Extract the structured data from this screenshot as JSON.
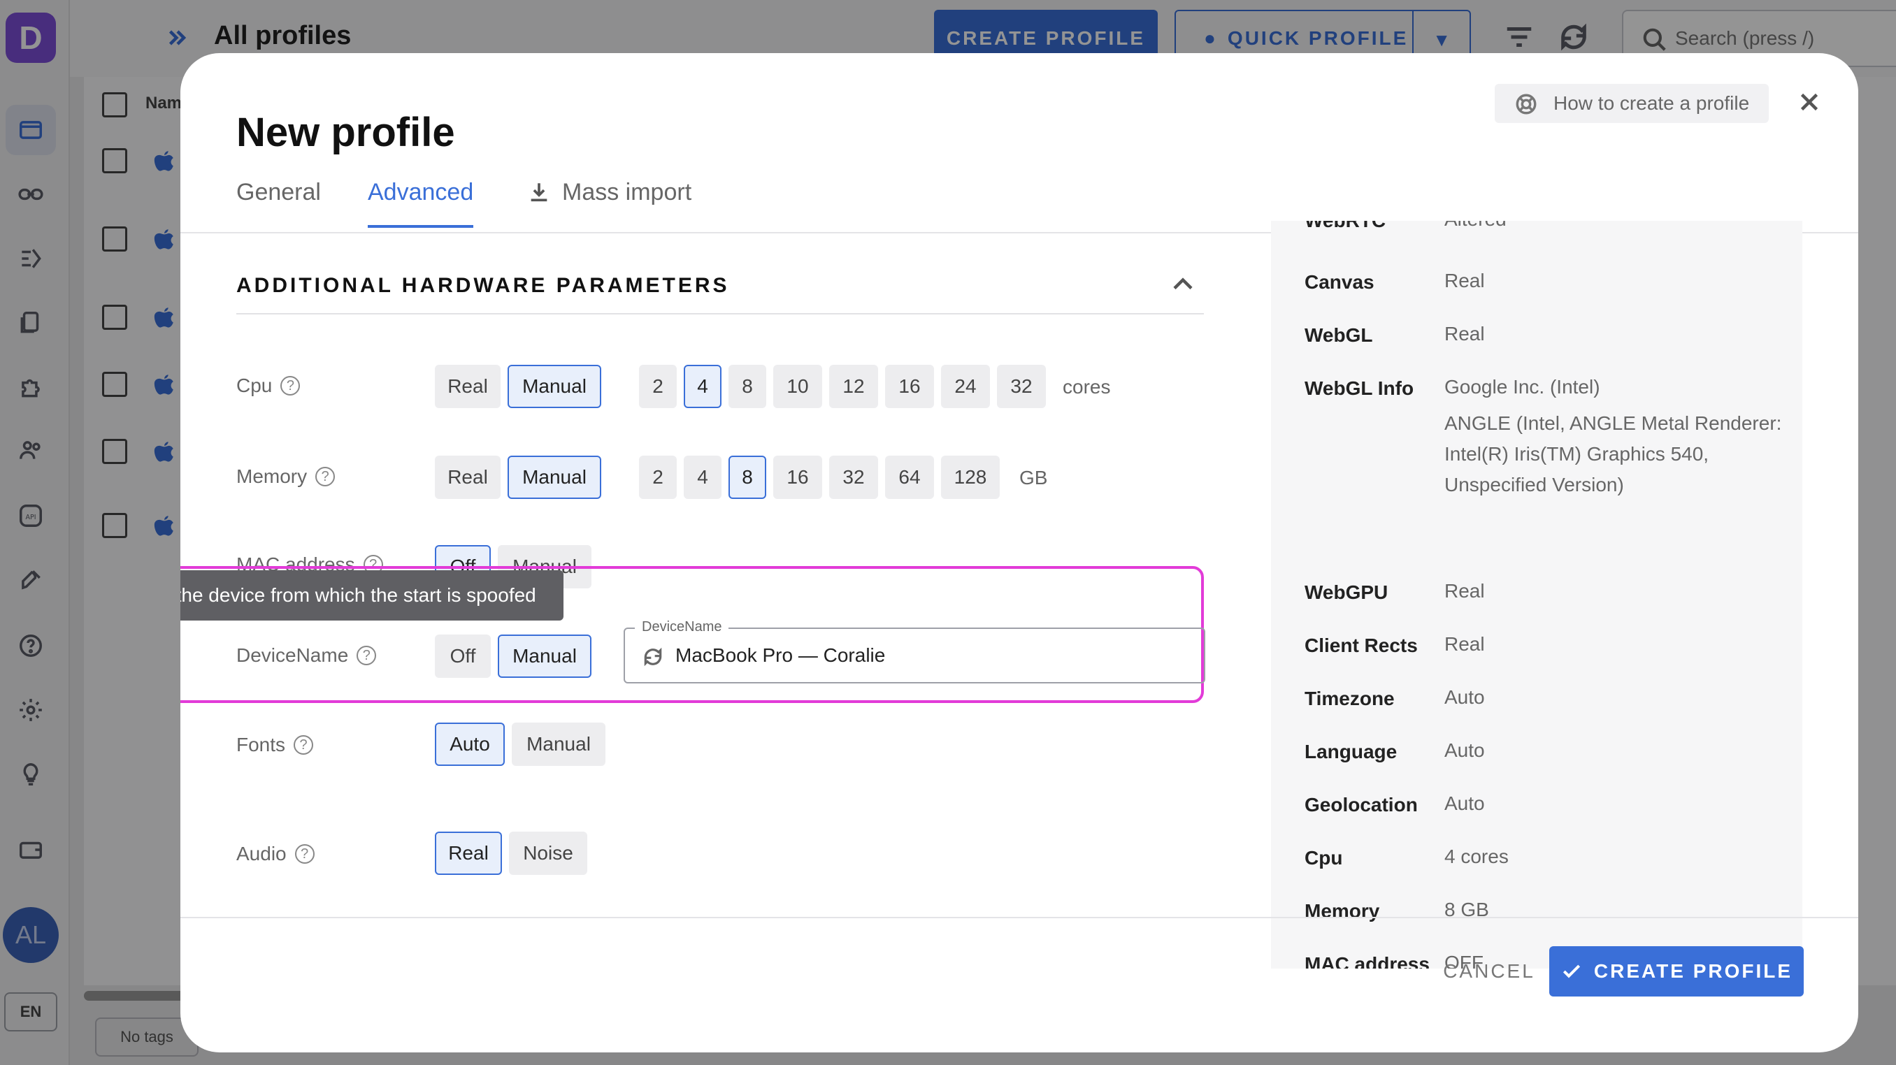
{
  "app": {
    "logo_letter": "D",
    "page_title": "All profiles",
    "create_profile_label": "CREATE PROFILE",
    "quick_profile_label": "QUICK PROFILE",
    "search_placeholder": "Search (press /)",
    "column_name": "Nam",
    "no_tags_label": "No tags",
    "avatar_initials": "AL",
    "language": "EN"
  },
  "modal": {
    "title": "New profile",
    "help_label": "How to create a profile",
    "tabs": [
      {
        "label": "General"
      },
      {
        "label": "Advanced"
      },
      {
        "label": "Mass import"
      }
    ],
    "section_title": "ADDITIONAL HARDWARE PARAMETERS",
    "params": {
      "cpu": {
        "label": "Cpu",
        "modes": [
          "Real",
          "Manual"
        ],
        "selected_mode": "Manual",
        "values": [
          "2",
          "4",
          "8",
          "10",
          "12",
          "16",
          "24",
          "32"
        ],
        "selected_value": "4",
        "unit": "cores"
      },
      "memory": {
        "label": "Memory",
        "modes": [
          "Real",
          "Manual"
        ],
        "selected_mode": "Manual",
        "values": [
          "2",
          "4",
          "8",
          "16",
          "32",
          "64",
          "128"
        ],
        "selected_value": "8",
        "unit": "GB"
      },
      "mac": {
        "label": "MAC address",
        "modes": [
          "Off",
          "Manual"
        ],
        "selected_mode": "Off"
      },
      "device_name": {
        "label": "DeviceName",
        "modes": [
          "Off",
          "Manual"
        ],
        "selected_mode": "Manual",
        "field_legend": "DeviceName",
        "field_value": "MacBook Pro — Coralie"
      },
      "fonts": {
        "label": "Fonts",
        "modes": [
          "Auto",
          "Manual"
        ],
        "selected_mode": "Auto"
      },
      "audio": {
        "label": "Audio",
        "modes": [
          "Real",
          "Noise"
        ],
        "selected_mode": "Real"
      }
    },
    "tooltip": "Name of the device from which the start is spoofed",
    "summary": [
      {
        "key": "WebRTC",
        "value": "Altered"
      },
      {
        "key": "Canvas",
        "value": "Real"
      },
      {
        "key": "WebGL",
        "value": "Real"
      },
      {
        "key": "WebGL Info",
        "value": "Google Inc. (Intel)",
        "extra": "ANGLE (Intel, ANGLE Metal Renderer: Intel(R) Iris(TM) Graphics 540, Unspecified Version)"
      },
      {
        "key": "WebGPU",
        "value": "Real"
      },
      {
        "key": "Client Rects",
        "value": "Real"
      },
      {
        "key": "Timezone",
        "value": "Auto"
      },
      {
        "key": "Language",
        "value": "Auto"
      },
      {
        "key": "Geolocation",
        "value": "Auto"
      },
      {
        "key": "Cpu",
        "value": "4 cores"
      },
      {
        "key": "Memory",
        "value": "8 GB"
      },
      {
        "key": "MAC address",
        "value": "OFF"
      }
    ],
    "cancel_label": "CANCEL",
    "create_label": "CREATE PROFILE"
  },
  "colors": {
    "accent": "#3a6fd8",
    "highlight": "#e23bd8",
    "brand": "#7c4ed8"
  }
}
